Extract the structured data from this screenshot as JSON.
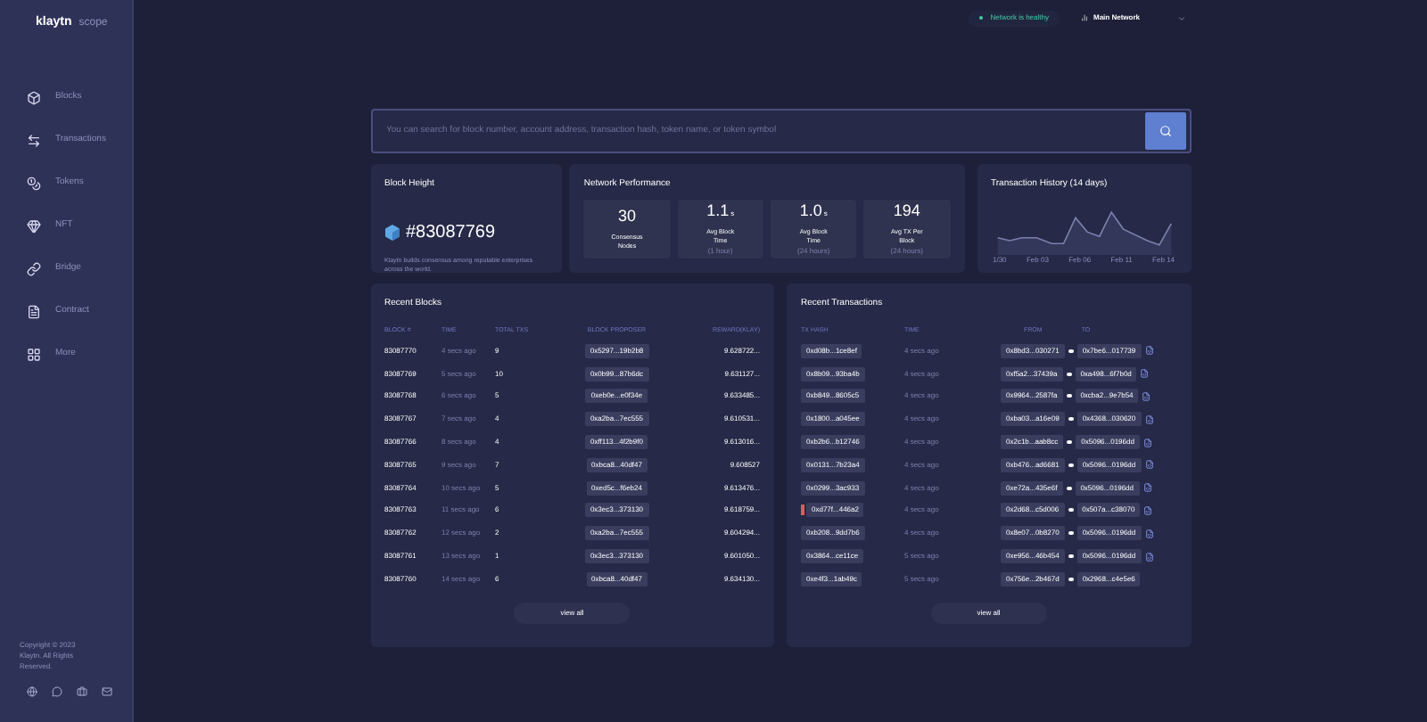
{
  "logo": {
    "name": "klaytn",
    "suffix": "scope"
  },
  "sidebar": {
    "items": [
      {
        "label": "Blocks"
      },
      {
        "label": "Transactions"
      },
      {
        "label": "Tokens"
      },
      {
        "label": "NFT"
      },
      {
        "label": "Bridge"
      },
      {
        "label": "Contract"
      },
      {
        "label": "More"
      }
    ],
    "copyright": "Copyright © 2023 Klaytn. All Rights Reserved."
  },
  "top_bar": {
    "status": {
      "label": "Network is healthy",
      "healthy": true
    },
    "network": "Main Network"
  },
  "search": {
    "placeholder": "You can search for block number, account address, transaction hash, token name, or token symbol"
  },
  "block_height": {
    "title": "Block Height",
    "value": "#83087769",
    "description": "Klaytn builds consensus among reputable enterprises across the world."
  },
  "network_performance": {
    "title": "Network Performance",
    "stats": [
      {
        "value": "30",
        "label": "Consensus Nodes"
      },
      {
        "value": "1.1",
        "unit": "s",
        "label": "Avg Block Time",
        "sub": "(1 hour)"
      },
      {
        "value": "1.0",
        "unit": "s",
        "label": "Avg Block Time",
        "sub": "(24 hours)"
      },
      {
        "value": "194",
        "label": "Avg TX Per Block",
        "sub": "(24 hours)"
      }
    ]
  },
  "transaction_history": {
    "title": "Transaction History (14 days)",
    "x_labels": [
      "1/30",
      "Feb 03",
      "Feb 06",
      "Feb 11",
      "Feb 14"
    ]
  },
  "recent_blocks": {
    "title": "Recent Blocks",
    "columns": [
      "BLOCK #",
      "TIME",
      "TOTAL TXS",
      "BLOCK PROPOSER",
      "REWARD(KLAY)"
    ],
    "rows": [
      [
        "83087770",
        "4 secs ago",
        "9",
        "0x5297...19b2b8",
        "9.628722..."
      ],
      [
        "83087769",
        "5 secs ago",
        "10",
        "0x0b99...87b6dc",
        "9.631127..."
      ],
      [
        "83087768",
        "6 secs ago",
        "5",
        "0xeb0e...e0f34e",
        "9.633485..."
      ],
      [
        "83087767",
        "7 secs ago",
        "4",
        "0xa2ba...7ec555",
        "9.610531..."
      ],
      [
        "83087766",
        "8 secs ago",
        "4",
        "0xff113...4f2b9f0",
        "9.613016..."
      ],
      [
        "83087765",
        "9 secs ago",
        "7",
        "0xbca8...40df47",
        "9.608527"
      ],
      [
        "83087764",
        "10 secs ago",
        "5",
        "0xed5c...f6eb24",
        "9.613476..."
      ],
      [
        "83087763",
        "11 secs ago",
        "6",
        "0x3ec3...373130",
        "9.618759..."
      ],
      [
        "83087762",
        "12 secs ago",
        "2",
        "0xa2ba...7ec555",
        "9.604294..."
      ],
      [
        "83087761",
        "13 secs ago",
        "1",
        "0x3ec3...373130",
        "9.601050..."
      ],
      [
        "83087760",
        "14 secs ago",
        "6",
        "0xbca8...40df47",
        "9.634130..."
      ]
    ],
    "view_all": "view all"
  },
  "recent_transactions": {
    "title": "Recent Transactions",
    "columns": [
      "TX HASH",
      "TIME",
      "FROM",
      "TO"
    ],
    "rows": [
      {
        "hash": "0xd08b...1ce8ef",
        "time": "4 secs ago",
        "from": "0x8bd3...030271",
        "to": "0x7be6...017739",
        "failed": false,
        "contract": true
      },
      {
        "hash": "0x8b09...93ba4b",
        "time": "4 secs ago",
        "from": "0xf5a2...37439a",
        "to": "0xa498...6f7b0d",
        "failed": false,
        "contract": true
      },
      {
        "hash": "0xb849...8605c5",
        "time": "4 secs ago",
        "from": "0x9964...2587fa",
        "to": "0xcba2...9e7b54",
        "failed": false,
        "contract": true
      },
      {
        "hash": "0x1800...a045ee",
        "time": "4 secs ago",
        "from": "0xba03...a16e09",
        "to": "0x4368...030620",
        "failed": false,
        "contract": true
      },
      {
        "hash": "0xb2b6...b12746",
        "time": "4 secs ago",
        "from": "0x2c1b...aab8cc",
        "to": "0x5096...0196dd",
        "failed": false,
        "contract": true
      },
      {
        "hash": "0x0131...7b23a4",
        "time": "4 secs ago",
        "from": "0xb476...ad6681",
        "to": "0x5096...0196dd",
        "failed": false,
        "contract": true
      },
      {
        "hash": "0x0299...3ac933",
        "time": "4 secs ago",
        "from": "0xe72a...435e6f",
        "to": "0x5096...0196dd",
        "failed": false,
        "contract": true
      },
      {
        "hash": "0xd77f...446a2",
        "time": "4 secs ago",
        "from": "0x2d68...c5d006",
        "to": "0x507a...c38070",
        "failed": true,
        "contract": true
      },
      {
        "hash": "0xb208...9dd7b6",
        "time": "4 secs ago",
        "from": "0x8e07...0b8270",
        "to": "0x5096...0196dd",
        "failed": false,
        "contract": true
      },
      {
        "hash": "0x3864...ce11ce",
        "time": "5 secs ago",
        "from": "0xe956...46b454",
        "to": "0x5096...0196dd",
        "failed": false,
        "contract": true
      },
      {
        "hash": "0xe4f3...1ab49c",
        "time": "5 secs ago",
        "from": "0x756e...2b467d",
        "to": "0x2968...c4e5e6",
        "failed": false,
        "contract": false
      }
    ],
    "view_all": "view all"
  }
}
